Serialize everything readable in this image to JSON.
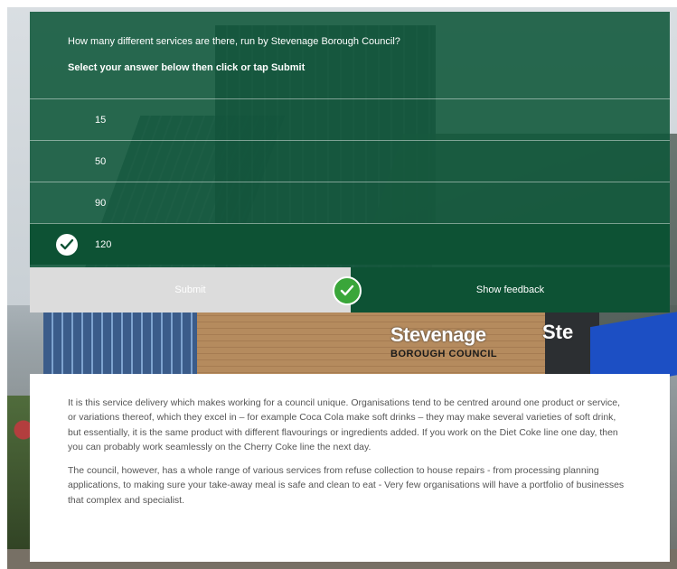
{
  "quiz": {
    "question": "How many different services are there, run by Stevenage Borough Council?",
    "instruction": "Select your answer below then click or tap Submit",
    "options": [
      {
        "label": "15",
        "selected": false
      },
      {
        "label": "50",
        "selected": false
      },
      {
        "label": "90",
        "selected": false
      },
      {
        "label": "120",
        "selected": true
      }
    ]
  },
  "actions": {
    "submit_label": "Submit",
    "feedback_label": "Show feedback"
  },
  "background": {
    "sign_main": "Stevenage",
    "sign_sub": "BOROUGH COUNCIL",
    "sign_side": "Ste"
  },
  "article": {
    "paragraphs": [
      "It is this service delivery which makes working for a council unique. Organisations tend to be centred around one product or service, or variations thereof, which they excel in – for example Coca Cola make soft drinks – they may make several varieties of soft drink, but essentially, it is the same product with different flavourings or ingredients added. If you work on the Diet Coke line one day, then you can probably work seamlessly on the Cherry Coke line the next day.",
      "The council, however, has a whole range of various services from refuse collection to house repairs - from processing planning applications, to making sure your take-away meal is safe and clean to eat - Very few organisations will have a portfolio of businesses that complex and specialist."
    ]
  },
  "colors": {
    "panel_green": "#0e5639",
    "selected_green": "#0d5234",
    "check_green": "#3aa63a",
    "submit_disabled": "#dcdcdc"
  }
}
